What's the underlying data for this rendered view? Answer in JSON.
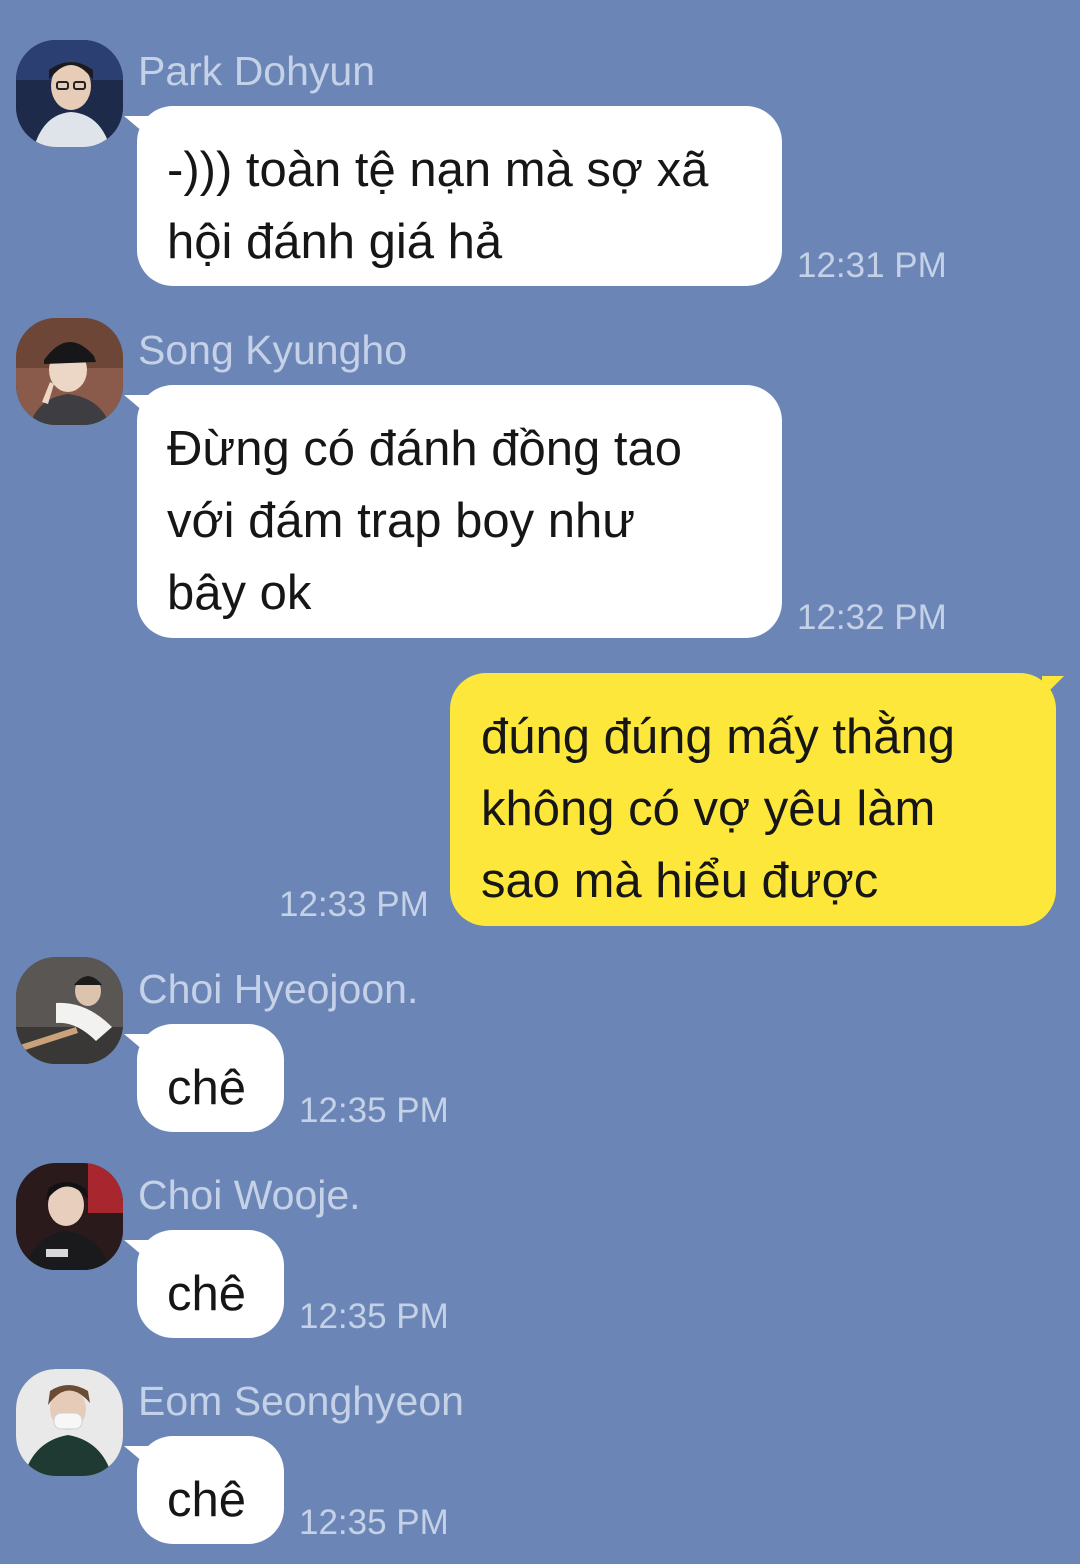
{
  "messages": [
    {
      "sender": "Park Dohyun",
      "text": "-))) toàn tệ nạn mà sợ xã\nhội đánh giá hả",
      "time": "12:31 PM"
    },
    {
      "sender": "Song Kyungho",
      "text": "Đừng có đánh đồng tao\nvới đám trap boy như\nbây ok",
      "time": "12:32 PM"
    },
    {
      "text": "đúng đúng mấy thằng\nkhông có vợ yêu làm\nsao mà hiểu được",
      "time": "12:33 PM"
    },
    {
      "sender": "Choi Hyeojoon.",
      "text": "chê",
      "time": "12:35 PM"
    },
    {
      "sender": "Choi Wooje.",
      "text": "chê",
      "time": "12:35 PM"
    },
    {
      "sender": "Eom Seonghyeon",
      "text": "chê",
      "time": "12:35 PM"
    }
  ],
  "colors": {
    "background": "#6b86b6",
    "incoming_bubble": "#ffffff",
    "outgoing_bubble": "#fde73a",
    "meta_text": "#c4d1e6"
  }
}
